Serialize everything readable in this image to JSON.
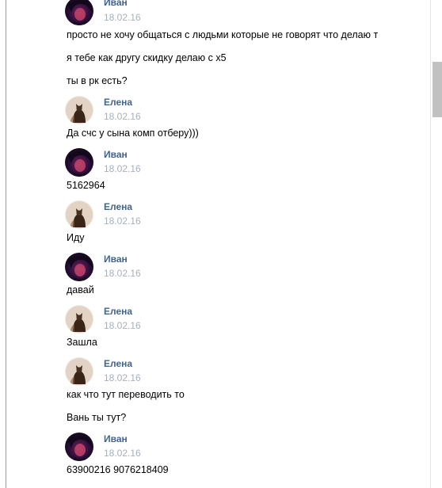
{
  "colors": {
    "author": "#42648b",
    "date": "#a8b0ba",
    "text": "#000000",
    "background": "#ffffff"
  },
  "messages": [
    {
      "author": "Иван",
      "date": "18.02.16",
      "avatar": "ivan-avatar",
      "texts": [
        "просто не хочу общаться с людьми которые не говорят что делаю т",
        "я тебе как другу скидку делаю с х5",
        "ты в рк есть?"
      ]
    },
    {
      "author": "Елена",
      "date": "18.02.16",
      "avatar": "elena-avatar",
      "texts": [
        "Да счс у сына комп отберу)))"
      ]
    },
    {
      "author": "Иван",
      "date": "18.02.16",
      "avatar": "ivan-avatar",
      "texts": [
        "5162964"
      ]
    },
    {
      "author": "Елена",
      "date": "18.02.16",
      "avatar": "elena-avatar",
      "texts": [
        "Иду"
      ]
    },
    {
      "author": "Иван",
      "date": "18.02.16",
      "avatar": "ivan-avatar",
      "texts": [
        "давай"
      ]
    },
    {
      "author": "Елена",
      "date": "18.02.16",
      "avatar": "elena-avatar",
      "texts": [
        "Зашла"
      ]
    },
    {
      "author": "Елена",
      "date": "18.02.16",
      "avatar": "elena-avatar",
      "texts": [
        "как что тут переводить то",
        "Вань ты тут?"
      ]
    },
    {
      "author": "Иван",
      "date": "18.02.16",
      "avatar": "ivan-avatar",
      "texts": [
        "63900216 9076218409"
      ]
    }
  ]
}
